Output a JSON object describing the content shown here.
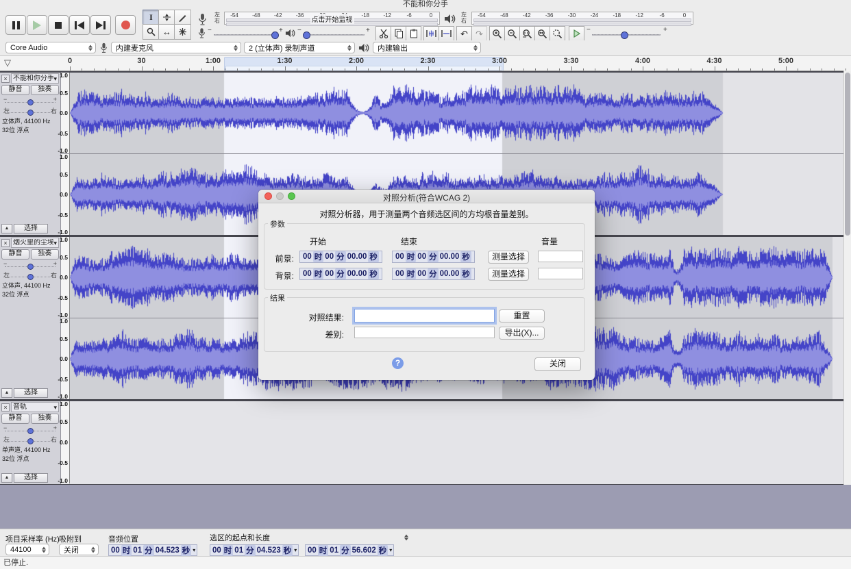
{
  "window": {
    "title": "不能和你分手",
    "status": "已停止."
  },
  "glyphs": {
    "close": "×",
    "caret_down": "▾",
    "collapse": "▲",
    "funnel": "▽",
    "minus": "−",
    "plus": "+",
    "undo": "↶",
    "redo": "↷",
    "ibeam": "I",
    "timeshift": "↔",
    "help": "?"
  },
  "icons": {
    "pause": "two-bars",
    "play": "green-triangle",
    "stop": "black-square",
    "skip-start": "triangle-bar",
    "skip-end": "bar-triangle",
    "record": "red-circle",
    "selection-tool": "I-beam",
    "envelope-tool": "envelope",
    "draw-tool": "pencil",
    "zoom-tool": "magnifier",
    "timeshift-tool": "double-arrow",
    "multi-tool": "star",
    "microphone": "mic",
    "speaker": "speaker",
    "cut": "scissors",
    "copy": "two-pages",
    "paste": "clipboard",
    "trim": "wave-trim",
    "silence": "wave-silence",
    "zoom-in": "magnifier-plus",
    "zoom-out": "magnifier-minus",
    "zoom-selection": "magnifier-sel",
    "zoom-project": "magnifier-fit",
    "zoom-toggle": "magnifier-toggle",
    "play-at-speed": "green-outline-triangle"
  },
  "device": {
    "host": "Core Audio",
    "input": "内建麦克风",
    "channels": "2 (立体声) 录制声道",
    "output": "内建输出"
  },
  "meters": {
    "channel_labels": [
      "左",
      "右"
    ],
    "scale": [
      "-54",
      "-48",
      "-42",
      "-36",
      "-30",
      "-24",
      "-18",
      "-12",
      "-6",
      "0"
    ],
    "monitor_hint": "点击开始监视"
  },
  "ruler": {
    "labels": [
      "0",
      "30",
      "1:00",
      "1:30",
      "2:00",
      "2:30",
      "3:00",
      "3:30",
      "4:00",
      "4:30",
      "5:00"
    ]
  },
  "amp_scale": [
    "1.0",
    "0.5",
    "0.0",
    "-0.5",
    "-1.0"
  ],
  "tracks": [
    {
      "name": "不能和你分手",
      "mute": "静音",
      "solo": "独奏",
      "pan_left": "左",
      "pan_right": "右",
      "format1": "立体声, 44100 Hz",
      "format2": "32位 浮点",
      "select": "选择"
    },
    {
      "name": "烟火里的尘埃",
      "mute": "静音",
      "solo": "独奏",
      "pan_left": "左",
      "pan_right": "右",
      "format1": "立体声, 44100 Hz",
      "format2": "32位 浮点",
      "select": "选择"
    },
    {
      "name": "音轨",
      "mute": "静音",
      "solo": "独奏",
      "pan_left": "左",
      "pan_right": "右",
      "format1": "单声道, 44100 Hz",
      "format2": "32位 浮点",
      "select": "选择"
    }
  ],
  "dialog": {
    "title": "对照分析(符合WCAG 2)",
    "description": "对照分析器，用于测量两个音频选区间的方均根音量差别。",
    "params_label": "参数",
    "col_start": "开始",
    "col_end": "结束",
    "col_volume": "音量",
    "foreground_label": "前景:",
    "background_label": "背景:",
    "time_value": "00 时 00 分 00.00 秒",
    "measure_button": "测量选择",
    "results_label": "结果",
    "contrast_label": "对照结果:",
    "reset_button": "重置",
    "difference_label": "差别:",
    "export_button": "导出(X)...",
    "close_button": "关闭",
    "contrast_value": "",
    "difference_value": ""
  },
  "selection_bar": {
    "rate_label": "项目采样率 (Hz)",
    "rate_value": "44100",
    "snap_label": "吸附到",
    "snap_value": "关闭",
    "position_label": "音频位置",
    "position_value": "00 时 01 分 04.523 秒",
    "range_label": "选区的起点和长度",
    "sel_start_value": "00 时 01 分 04.523 秒",
    "sel_length_value": "00 时 01 分 56.602 秒"
  }
}
